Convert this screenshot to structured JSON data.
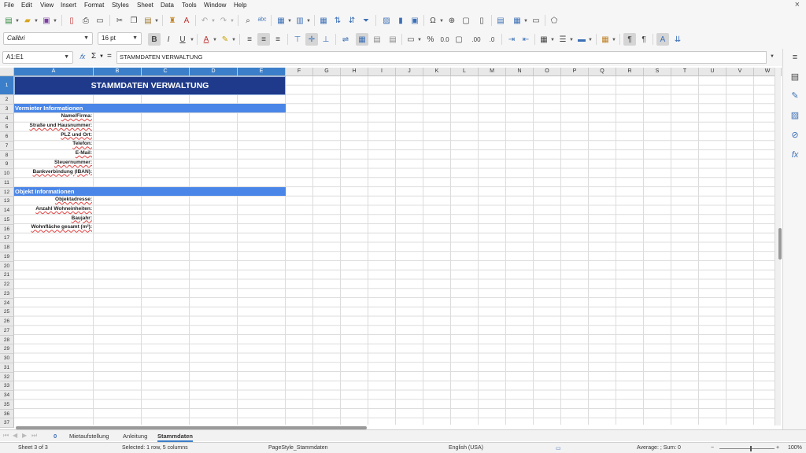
{
  "menu": [
    "File",
    "Edit",
    "View",
    "Insert",
    "Format",
    "Styles",
    "Sheet",
    "Data",
    "Tools",
    "Window",
    "Help"
  ],
  "close_glyph": "×",
  "font": {
    "name": "Calibri",
    "size": "16 pt"
  },
  "formula": {
    "name_box": "A1:E1",
    "fx": "𝑓x",
    "sigma": "Σ",
    "equals": "=",
    "content": "STAMMDATEN VERWALTUNG"
  },
  "columns": [
    "A",
    "B",
    "C",
    "D",
    "E",
    "F",
    "G",
    "H",
    "I",
    "J",
    "K",
    "L",
    "M",
    "N",
    "O",
    "P",
    "Q",
    "R",
    "S",
    "T",
    "U",
    "V",
    "W"
  ],
  "rows": [
    "1",
    "2",
    "3",
    "4",
    "5",
    "6",
    "7",
    "8",
    "9",
    "10",
    "11",
    "12",
    "13",
    "14",
    "15",
    "16",
    "17",
    "18",
    "19",
    "20",
    "21",
    "22",
    "23",
    "24",
    "25",
    "26",
    "27",
    "28",
    "29",
    "30",
    "31",
    "32",
    "33",
    "34",
    "35",
    "36",
    "37"
  ],
  "sheet": {
    "title": "STAMMDATEN VERWALTUNG",
    "section1": "Vermieter Informationen",
    "landlord_fields": [
      "Name/Firma:",
      "Straße und Hausnummer:",
      "PLZ und Ort:",
      "Telefon:",
      "E-Mail:",
      "Steuernummer:",
      "Bankverbindung (IBAN):"
    ],
    "section2": "Objekt Informationen",
    "property_fields": [
      "Objektadresse:",
      "Anzahl Wohneinheiten:",
      "Baujahr:",
      "Wohnfläche gesamt (m²):"
    ]
  },
  "tabs": {
    "count": "0",
    "items": [
      "Mietaufstellung",
      "Anleitung",
      "Stammdaten"
    ],
    "active": "Stammdaten"
  },
  "status": {
    "sheet": "Sheet 3 of 3",
    "selection": "Selected: 1 row, 5 columns",
    "page_style": "PageStyle_Stammdaten",
    "language": "English (USA)",
    "sum": "Average: ; Sum: 0",
    "zoom": "100%"
  },
  "colors": {
    "accent": "#3b7ec9",
    "title_bg": "#1f3a8a",
    "section_bg": "#4a86e8"
  },
  "icons": {
    "toolbar1": [
      "new-icon",
      "open-icon",
      "save-icon",
      "export-pdf-icon",
      "print-icon",
      "print-preview-icon",
      "cut-icon",
      "copy-icon",
      "paste-icon",
      "clone-format-icon",
      "clear-format-icon",
      "undo-icon",
      "redo-icon",
      "find-replace-icon",
      "spellcheck-icon",
      "row-icon",
      "column-icon",
      "headers-icon",
      "sort-ascending-icon",
      "sort-descending-icon",
      "autofilter-icon",
      "image-icon",
      "chart-icon",
      "pivot-icon",
      "special-char-icon",
      "hyperlink-icon",
      "comment-icon",
      "headers-footers-icon",
      "define-print-area-icon",
      "freeze-icon",
      "split-window-icon",
      "show-draw-icon"
    ]
  }
}
